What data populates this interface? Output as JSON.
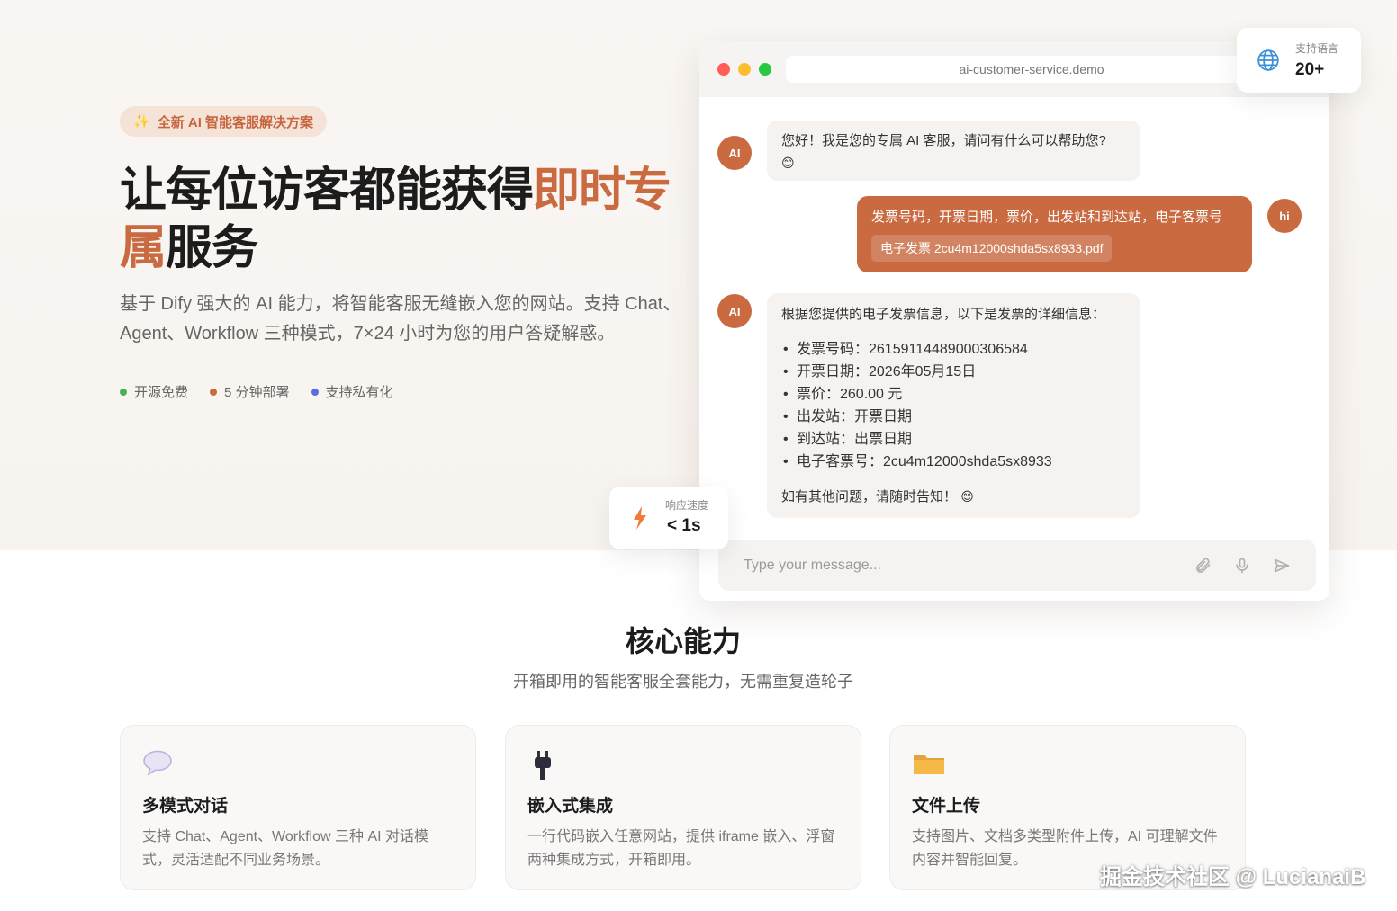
{
  "hero": {
    "badge_label": "全新 AI 智能客服解决方案",
    "badge_icon": "sparkle-icon",
    "title_part1": "让每位访客都能获得",
    "title_accent1": "即时专",
    "title_accent2": "属",
    "title_part2": "服务",
    "description": "基于 Dify 强大的 AI 能力，将智能客服无缝嵌入您的网站。支持 Chat、Agent、Workflow 三种模式，7×24 小时为您的用户答疑解惑。",
    "features": [
      {
        "label": "开源免费",
        "color": "#4caf50"
      },
      {
        "label": "5 分钟部署",
        "color": "#c96a40"
      },
      {
        "label": "支持私有化",
        "color": "#5b6ee1"
      }
    ]
  },
  "chat": {
    "url": "ai-customer-service.demo",
    "ai_avatar": "AI",
    "user_avatar": "hi",
    "greeting": "您好！我是您的专属 AI 客服，请问有什么可以帮助您?",
    "greeting_emoji": "😊",
    "user_message": "发票号码，开票日期，票价，出发站和到达站，电子客票号",
    "user_attachment": "电子发票 2cu4m12000shda5sx8933.pdf",
    "reply_intro": "根据您提供的电子发票信息，以下是发票的详细信息：",
    "reply_items": [
      "发票号码：26159114489000306584",
      "开票日期：2026年05月15日",
      "票价：260.00 元",
      "出发站：开票日期",
      "到达站：出票日期",
      "电子客票号：2cu4m12000shda5sx8933"
    ],
    "reply_outro": "如有其他问题，请随时告知！",
    "reply_outro_emoji": "😊",
    "input_placeholder": "Type your message...",
    "input_icons": [
      "paperclip-icon",
      "microphone-icon",
      "send-icon"
    ]
  },
  "floating": {
    "language_label": "支持语言",
    "language_value": "20+",
    "language_icon": "globe-icon",
    "speed_label": "响应速度",
    "speed_value": "< 1s",
    "speed_icon": "lightning-icon"
  },
  "section": {
    "title": "核心能力",
    "subtitle": "开箱即用的智能客服全套能力，无需重复造轮子",
    "cards": [
      {
        "icon": "speech-bubble-icon",
        "title": "多模式对话",
        "desc": "支持 Chat、Agent、Workflow 三种 AI 对话模式，灵活适配不同业务场景。"
      },
      {
        "icon": "plug-icon",
        "title": "嵌入式集成",
        "desc": "一行代码嵌入任意网站，提供 iframe 嵌入、浮窗两种集成方式，开箱即用。"
      },
      {
        "icon": "folder-icon",
        "title": "文件上传",
        "desc": "支持图片、文档多类型附件上传，AI 可理解文件内容并智能回复。"
      }
    ]
  },
  "watermark": "掘金技术社区 @ LucianaiB",
  "colors": {
    "accent": "#c96a40",
    "badge_bg": "#f4e3d6",
    "hero_bg": "#f8f4f1"
  }
}
